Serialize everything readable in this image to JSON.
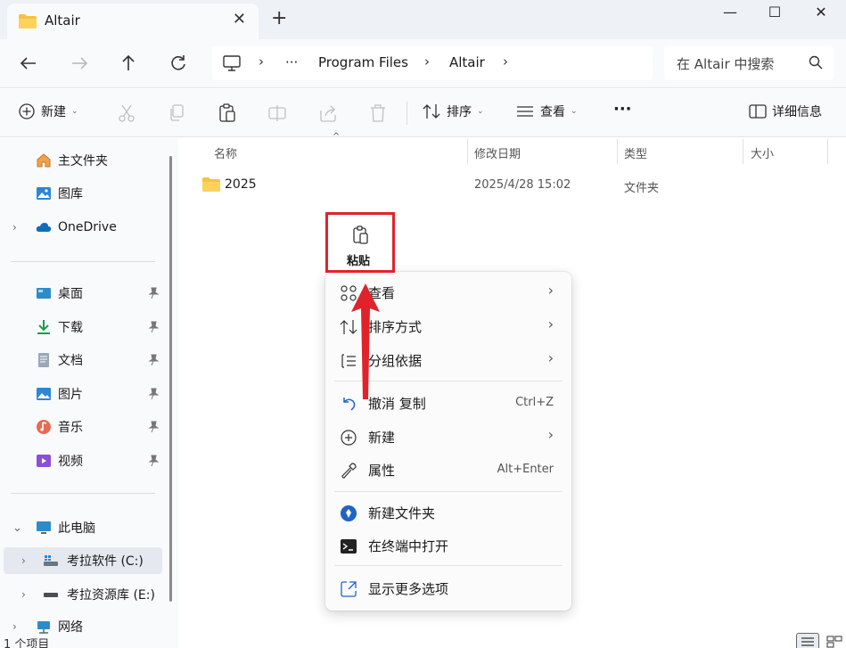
{
  "window": {
    "tab_title": "Altair",
    "new_tab": "+",
    "minimize": "—",
    "maximize": "☐",
    "close": "✕"
  },
  "address": {
    "overflow": "···",
    "crumbs": [
      "Program Files",
      "Altair"
    ],
    "search_placeholder": "在 Altair 中搜索"
  },
  "commands": {
    "new": "新建",
    "sort": "排序",
    "view": "查看",
    "more": "···",
    "details": "详细信息"
  },
  "sidebar": {
    "items": [
      {
        "label": "主文件夹",
        "icon": "home-icon"
      },
      {
        "label": "图库",
        "icon": "gallery-icon"
      },
      {
        "label": "OneDrive",
        "icon": "cloud-icon"
      },
      {
        "label": "桌面",
        "icon": "desktop-icon"
      },
      {
        "label": "下载",
        "icon": "download-icon"
      },
      {
        "label": "文档",
        "icon": "document-icon"
      },
      {
        "label": "图片",
        "icon": "pictures-icon"
      },
      {
        "label": "音乐",
        "icon": "music-icon"
      },
      {
        "label": "视频",
        "icon": "video-icon"
      },
      {
        "label": "此电脑",
        "icon": "computer-icon"
      },
      {
        "label": "考拉软件 (C:)",
        "icon": "drive-c-icon"
      },
      {
        "label": "考拉资源库 (E:)",
        "icon": "drive-e-icon"
      },
      {
        "label": "网络",
        "icon": "network-icon"
      }
    ]
  },
  "columns": {
    "name": "名称",
    "modified": "修改日期",
    "type": "类型",
    "size": "大小"
  },
  "files": [
    {
      "name": "2025",
      "modified": "2025/4/28 15:02",
      "type": "文件夹"
    }
  ],
  "context_menu": {
    "paste": "粘贴",
    "items": [
      {
        "label": "查看",
        "key": "",
        "submenu": true
      },
      {
        "label": "排序方式",
        "key": "",
        "submenu": true
      },
      {
        "label": "分组依据",
        "key": "",
        "submenu": true
      },
      {
        "label": "撤消 复制",
        "key": "Ctrl+Z",
        "submenu": false
      },
      {
        "label": "新建",
        "key": "",
        "submenu": true
      },
      {
        "label": "属性",
        "key": "Alt+Enter",
        "submenu": false
      },
      {
        "label": "新建文件夹",
        "key": "",
        "submenu": false
      },
      {
        "label": "在终端中打开",
        "key": "",
        "submenu": false
      },
      {
        "label": "显示更多选项",
        "key": "",
        "submenu": false
      }
    ]
  },
  "status": {
    "count": "1 个项目"
  },
  "colors": {
    "accent": "#0067c0",
    "folder": "#f5c242",
    "highlight_red": "#e0232b"
  }
}
